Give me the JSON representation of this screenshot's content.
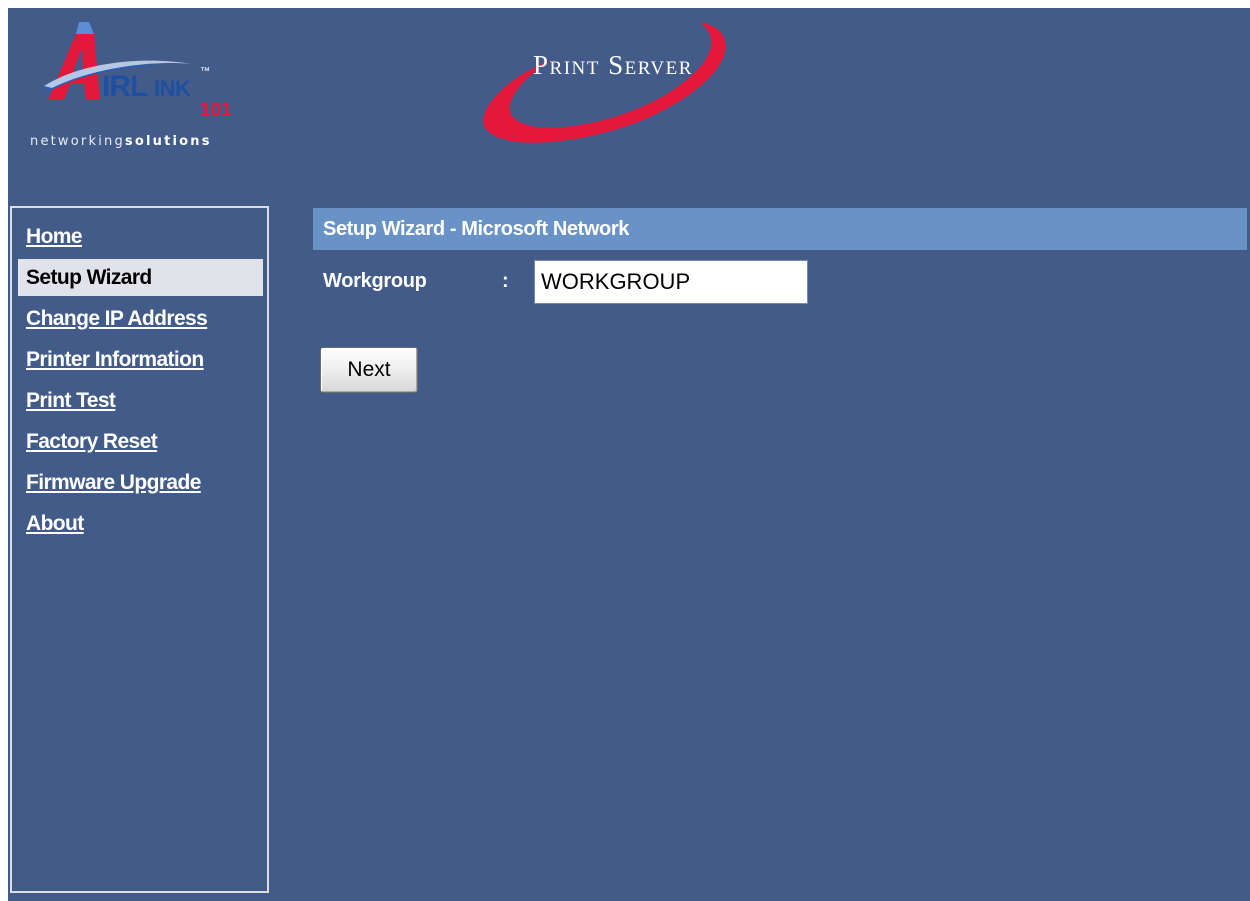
{
  "header": {
    "airlink_logo": {
      "brand_text": "AIRLINK",
      "suffix": "101",
      "tagline_light": "networking",
      "tagline_bold": "solutions"
    },
    "product_logo": {
      "text": "Print Server"
    }
  },
  "sidebar": {
    "items": [
      {
        "label": "Home",
        "active": false
      },
      {
        "label": "Setup Wizard",
        "active": true
      },
      {
        "label": "Change IP Address",
        "active": false
      },
      {
        "label": "Printer Information",
        "active": false
      },
      {
        "label": "Print Test",
        "active": false
      },
      {
        "label": "Factory Reset",
        "active": false
      },
      {
        "label": "Firmware Upgrade",
        "active": false
      },
      {
        "label": "About",
        "active": false
      }
    ]
  },
  "main": {
    "title": "Setup Wizard - Microsoft Network",
    "workgroup": {
      "label": "Workgroup",
      "separator": ":",
      "value": "WORKGROUP"
    },
    "next_button": "Next"
  },
  "colors": {
    "background": "#425b88",
    "title_bar": "#6993c6",
    "active_nav_bg": "#e2e3ea",
    "brand_red": "#e3183a"
  }
}
